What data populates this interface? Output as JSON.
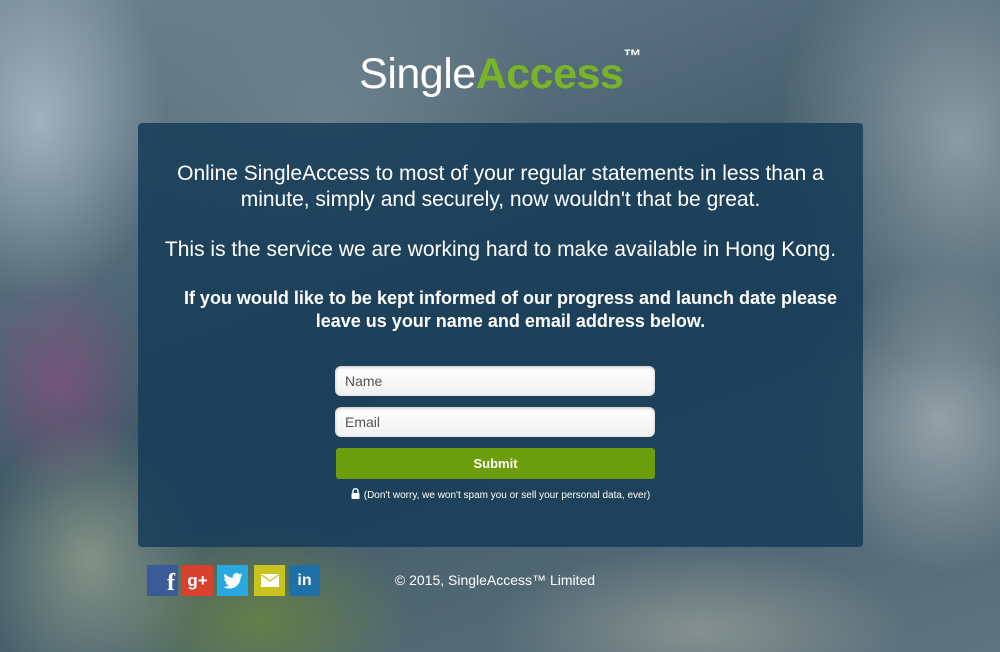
{
  "brand": {
    "name_part1": "Single",
    "name_part2": "Access",
    "trademark": "™",
    "accent_color": "#79b428"
  },
  "content": {
    "intro": "Online SingleAccess to most of your regular statements in less than a minute, simply and securely, now wouldn't that be great.",
    "service_note": "This is the service we are working hard to make available in Hong Kong.",
    "signup_prompt": "If you would like to be kept informed of our progress and launch date please leave us your name and email address below."
  },
  "form": {
    "name_placeholder": "Name",
    "email_placeholder": "Email",
    "submit_label": "Submit",
    "privacy_note": "(Don't worry, we won't spam you or sell your personal data, ever)",
    "submit_color": "#6b9e0d"
  },
  "social": {
    "icons": [
      "facebook-icon",
      "google-plus-icon",
      "twitter-icon",
      "email-icon",
      "linkedin-icon"
    ],
    "google_plus_glyph": "g+",
    "linkedin_glyph": "in",
    "facebook_glyph": "f"
  },
  "footer": {
    "copyright": "© 2015, SingleAccess™ Limited"
  },
  "colors": {
    "panel": "#173c58",
    "facebook": "#3b5a98",
    "google_plus": "#d8412e",
    "twitter": "#29a7df",
    "email": "#c9c320",
    "linkedin": "#1f6fa8"
  }
}
